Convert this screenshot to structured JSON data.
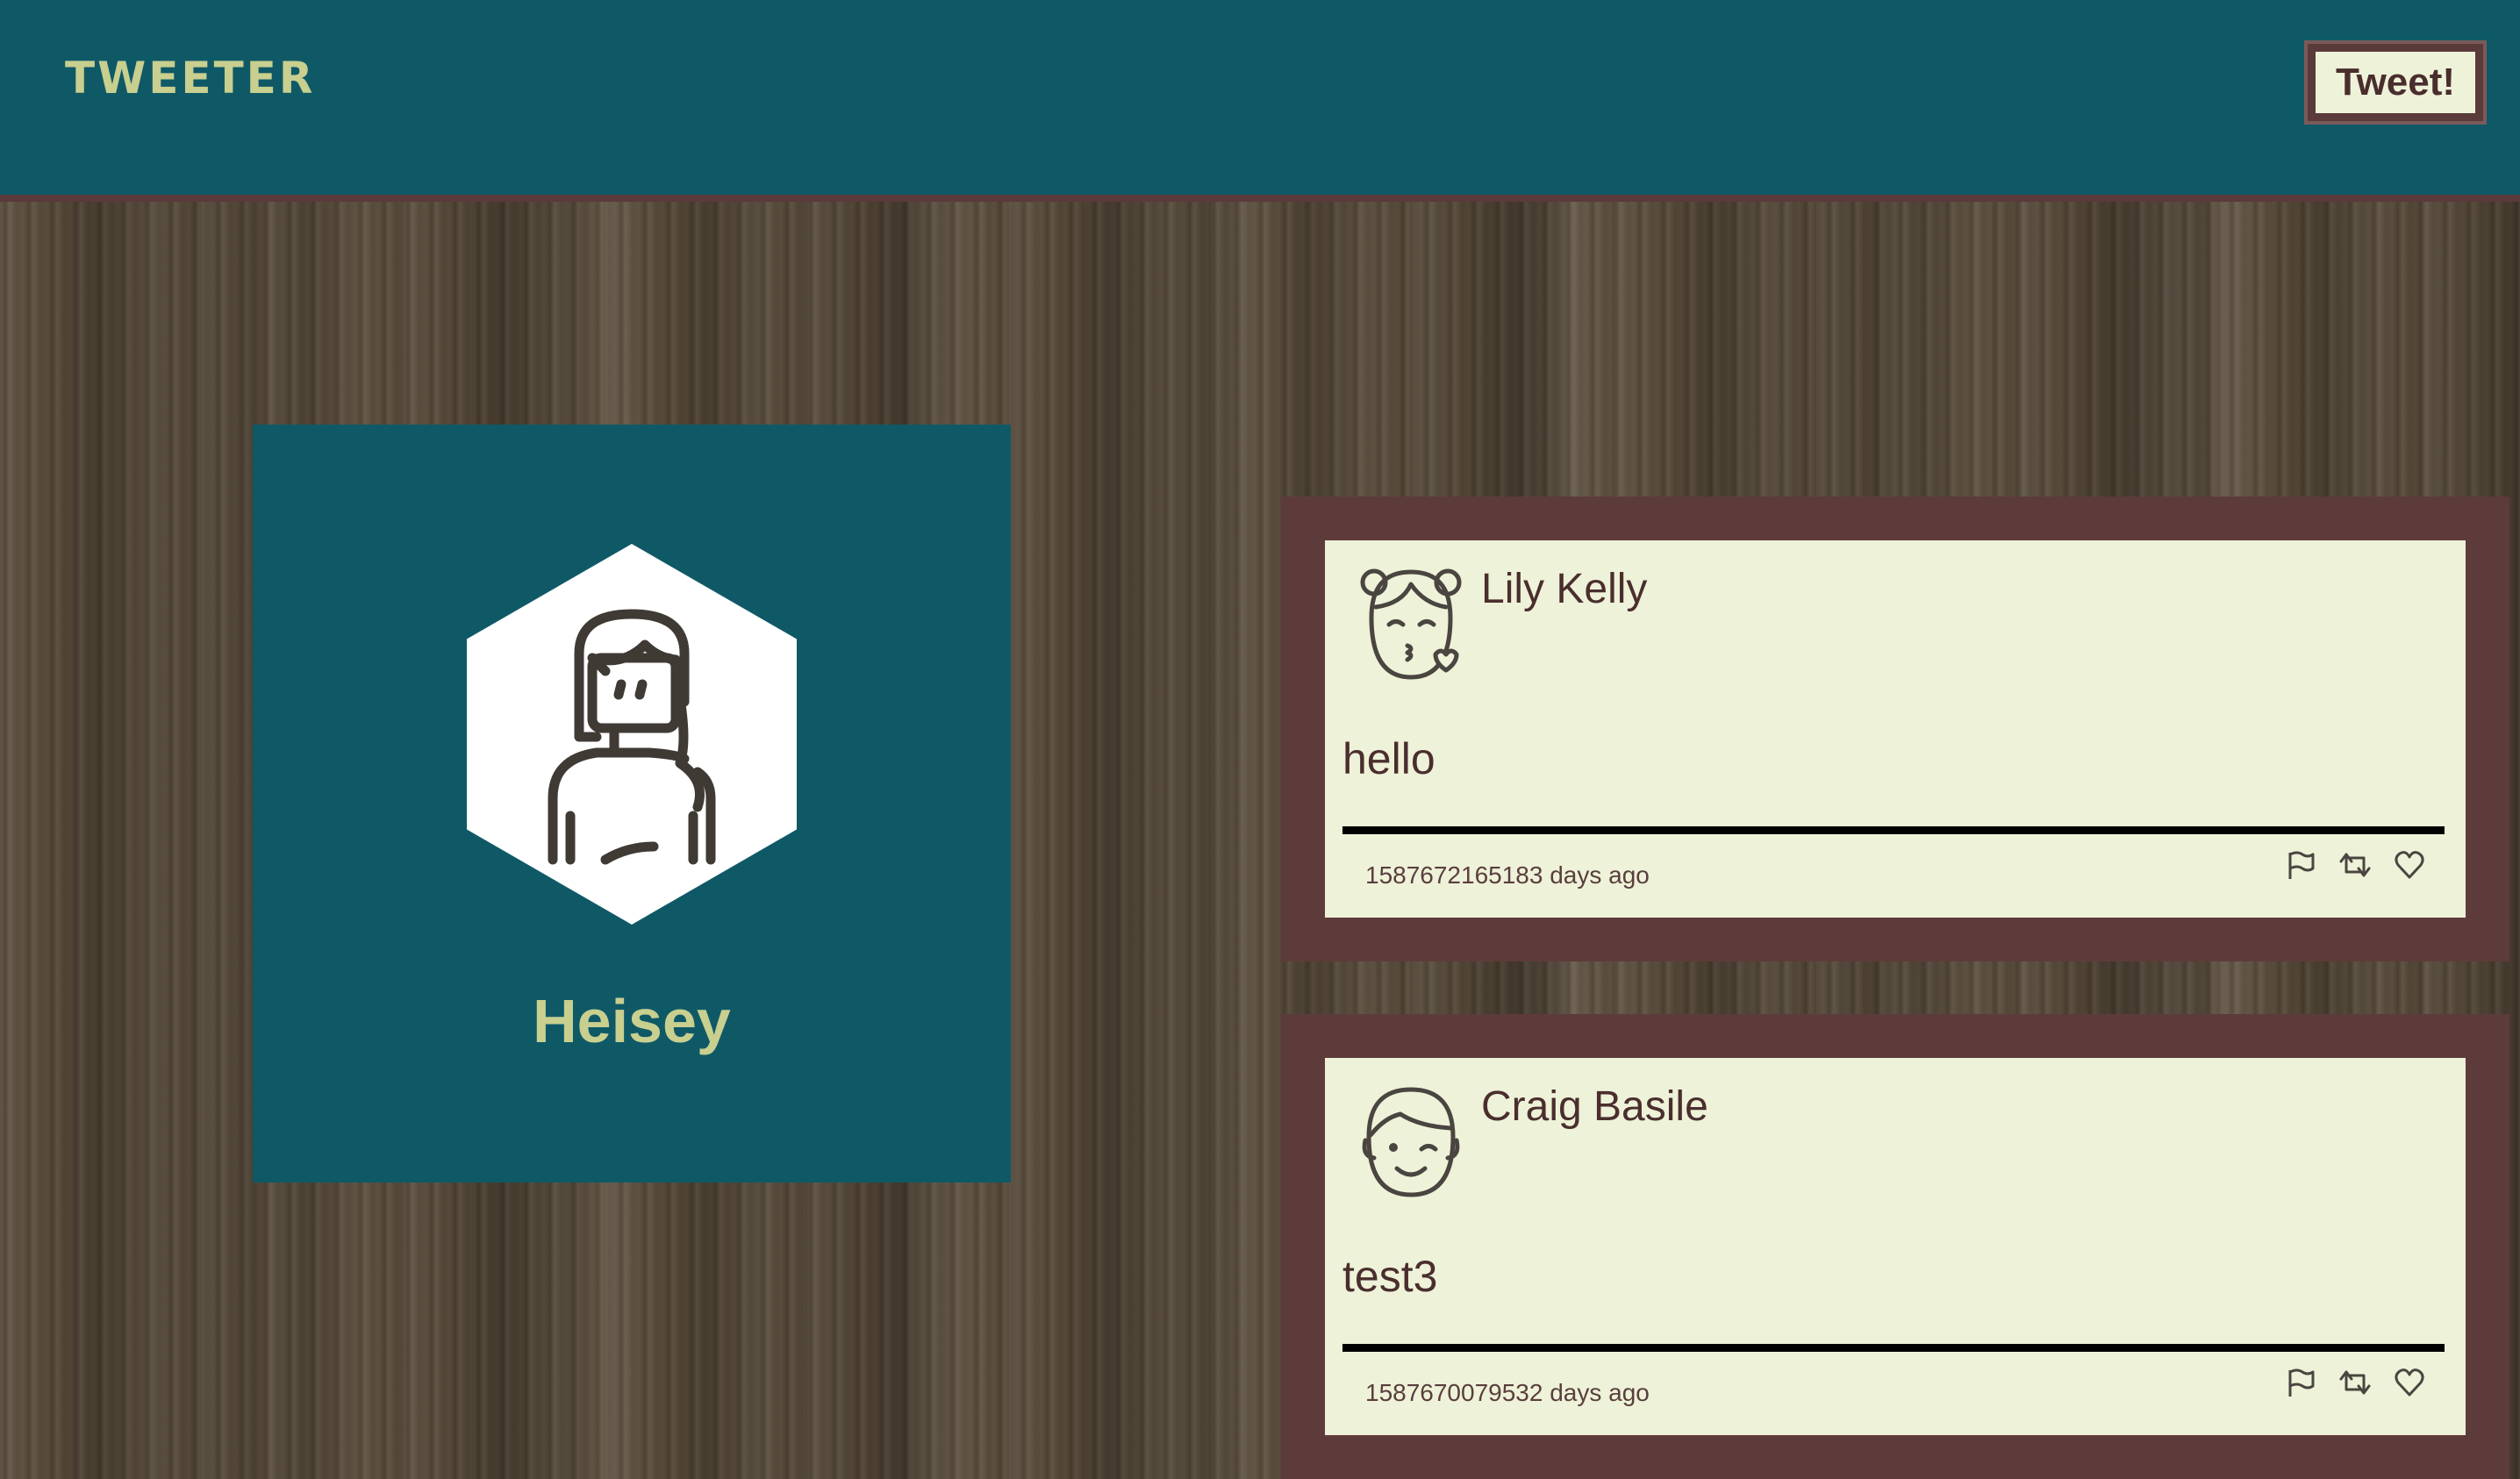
{
  "header": {
    "brand": "TWEETER",
    "tweet_button_label": "Tweet!"
  },
  "profile": {
    "avatar_icon": "woman-avatar-icon",
    "handle": "Heisey"
  },
  "tweets": [
    {
      "author": "Lily Kelly",
      "avatar_icon": "girl-kiss-avatar-icon",
      "content": "hello",
      "timestamp": "1587672165183 days ago",
      "actions": [
        "flag-icon",
        "retweet-icon",
        "heart-icon"
      ]
    },
    {
      "author": "Craig Basile",
      "avatar_icon": "boy-wink-avatar-icon",
      "content": "test3",
      "timestamp": "1587670079532 days ago",
      "actions": [
        "flag-icon",
        "retweet-icon",
        "heart-icon"
      ]
    }
  ],
  "colors": {
    "navbar": "#0f5967",
    "accent_text": "#c8cf8f",
    "tweet_frame": "#5e3b3b",
    "tweet_bg": "#eef2d8"
  }
}
